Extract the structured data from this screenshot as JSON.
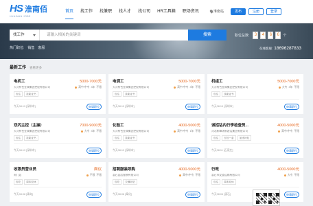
{
  "header": {
    "logo_mark": "HS",
    "logo_name": "淮南佰",
    "logo_tag": "HUAINAN JOBS",
    "nav": [
      "首页",
      "找工作",
      "找兼职",
      "找人才",
      "找公司",
      "HR工具箱",
      "职场资讯"
    ],
    "active_nav": 0,
    "city": "淮南站",
    "post_label": "发布",
    "register_label": "注册",
    "login_label": "登录"
  },
  "search": {
    "category": "找工作",
    "placeholder": "请输入相关的关键词",
    "button": "搜索",
    "hot_label": "热门职位:",
    "hot_items": [
      "销售",
      "客服"
    ]
  },
  "stats": {
    "label": "职位总数:",
    "digits": [
      "3",
      "4",
      "6",
      "6"
    ],
    "unit": "个",
    "hotline_label": "在线客服:",
    "hotline": "18696287833"
  },
  "section": {
    "title": "最新工作",
    "more": "查看更多"
  },
  "jobs": [
    {
      "title": "电机工",
      "salary": "5000-7000元",
      "company": "天河有色金属集团控股有限公司",
      "meta": [
        "高中/中专",
        "3年",
        "不限"
      ],
      "tags": [
        "包住",
        "技能证书"
      ],
      "date": "今天08:19 [深圳市]",
      "apply": "申请职位"
    },
    {
      "title": "电调工",
      "salary": "5000-7000元",
      "company": "天河有色金属集团控股有限公司",
      "meta": [
        "高中/中专",
        "3年",
        "不限"
      ],
      "tags": [
        "包住",
        "技能证书"
      ],
      "date": "今天08:19 [深圳市]",
      "apply": "申请职位"
    },
    {
      "title": "机组工",
      "salary": "5000-7000元",
      "company": "天河有色金属集团控股有限公司",
      "meta": [
        "大专",
        "3年",
        "不限"
      ],
      "tags": [
        "包住",
        "技能证书"
      ],
      "date": "今天08:19 [深圳市]",
      "apply": "申请职位"
    },
    {
      "title": "双闪主控（主操）",
      "salary": "7000-9000元",
      "company": "天河有色金属集团控股有限公司",
      "meta": [
        "大专",
        "3年",
        "不限"
      ],
      "tags": [
        "包住",
        "技能证书"
      ],
      "date": "今天08:19 [深圳市]",
      "apply": "申请职位"
    },
    {
      "title": "化验工",
      "salary": "4000-5000元",
      "company": "天河有色金属集团控股有限公司",
      "meta": [
        "高中/中专",
        "1年",
        "不限"
      ],
      "tags": [
        "包住",
        "技能证书"
      ],
      "date": "今天08:19 [深圳市]",
      "apply": "申请职位"
    },
    {
      "title": "诚招钻内行李检查员...",
      "salary": "4000-5000元",
      "company": "河北新峰场新客运集团有限公司",
      "meta": [
        "高中/中专",
        "不限"
      ],
      "tags": [
        "包住",
        "五险一金",
        "加班补贴"
      ],
      "date": "今天08:11 [石家庄]",
      "apply": "申请职位"
    },
    {
      "title": "收银员营业员",
      "salary": "面议",
      "company": "周门店",
      "meta": [
        "不限",
        "不限"
      ],
      "tags": [
        "包吃",
        "周末双休"
      ],
      "date": "今天08:08 [青岛]",
      "apply": "申请职位"
    },
    {
      "title": "招聘服装导购",
      "salary": "4000-5000元",
      "company": "惠石县店服装有限公司",
      "meta": [
        "高中/中专",
        "不限"
      ],
      "tags": [
        "包吃",
        "交通补贴"
      ],
      "date": "今天08:08 [奉化]",
      "apply": "申请职位"
    },
    {
      "title": "行政",
      "salary": "4000-5000元",
      "company": "惠石市友道运输有限公司",
      "meta": [
        "大专",
        "不限"
      ],
      "tags": [
        "包住",
        "周末双休"
      ],
      "date": "今天08:04 [惠石]",
      "apply": "申请职位"
    }
  ]
}
